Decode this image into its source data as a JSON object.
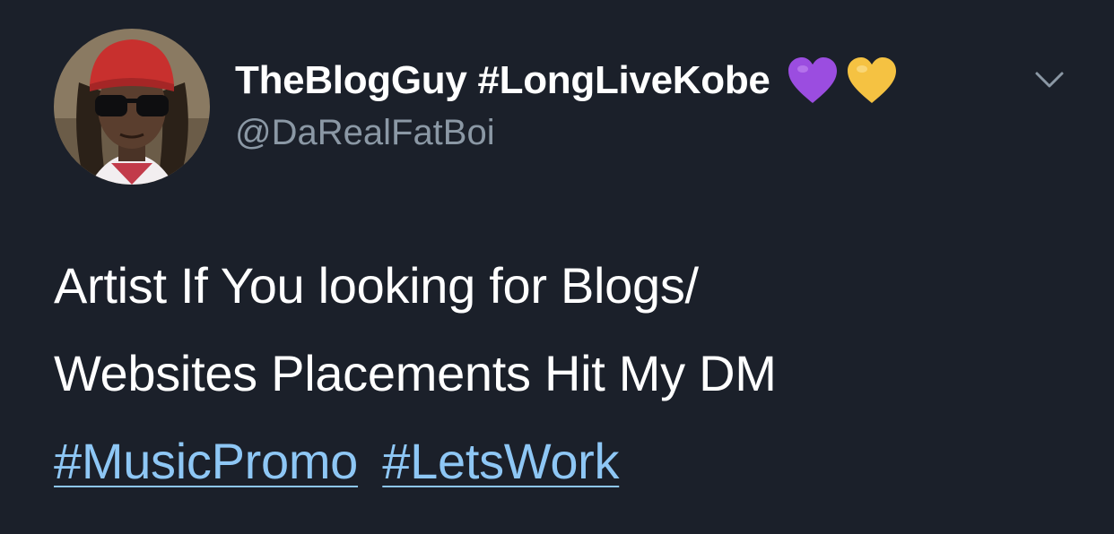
{
  "tweet": {
    "display_name": "TheBlogGuy #LongLiveKobe",
    "handle": "@DaRealFatBoi",
    "emojis": [
      {
        "icon": "purple-heart-icon",
        "color": "#9b4de0"
      },
      {
        "icon": "yellow-heart-icon",
        "color": "#f5c242"
      }
    ],
    "text_lines": [
      "Artist If You looking for Blogs/",
      "Websites Placements Hit My DM"
    ],
    "hashtags": [
      "#MusicPromo",
      "#LetsWork"
    ],
    "colors": {
      "background": "#1b202a",
      "text": "#ffffff",
      "secondary": "#8b98a5",
      "link": "#8ec7f5"
    }
  }
}
